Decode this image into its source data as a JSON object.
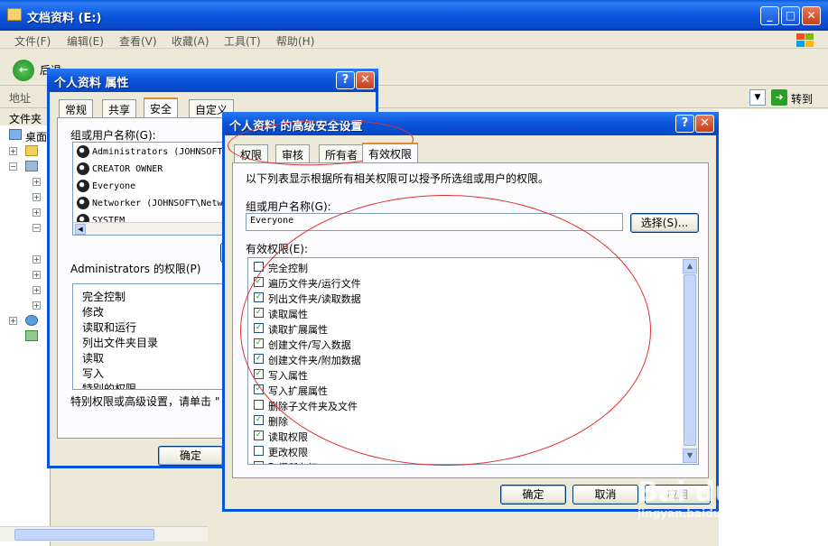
{
  "explorer": {
    "title": "文档资料 (E:)",
    "menu": [
      "文件(F)",
      "编辑(E)",
      "查看(V)",
      "收藏(A)",
      "工具(T)",
      "帮助(H)"
    ],
    "back_label": "后退",
    "address_label": "地址",
    "go_label": "转到",
    "folders_label": "文件夹",
    "tree_first": "桌面"
  },
  "properties": {
    "title": "个人资料 属性",
    "tabs": [
      "常规",
      "共享",
      "安全",
      "自定义"
    ],
    "active_tab": "安全",
    "group_label": "组或用户名称(G):",
    "users": [
      "Administrators (JOHNSOFT\\",
      "CREATOR OWNER",
      "Everyone",
      "Networker (JOHNSOFT\\Netw",
      "SYSTEM"
    ],
    "perm_label": "Administrators 的权限(P)",
    "perms": [
      "完全控制",
      "修改",
      "读取和运行",
      "列出文件夹目录",
      "读取",
      "写入",
      "特别的权限"
    ],
    "footer_text": "特别权限或高级设置，请单击 \"",
    "ok_label": "确定"
  },
  "advanced": {
    "title": "个人资料 的高级安全设置",
    "tabs": [
      "权限",
      "审核",
      "所有者",
      "有效权限"
    ],
    "active_tab": "有效权限",
    "description": "以下列表显示根据所有相关权限可以授予所选组或用户的权限。",
    "group_label": "组或用户名称(G):",
    "group_value": "Everyone",
    "select_label": "选择(S)...",
    "effective_label": "有效权限(E):",
    "permissions": [
      {
        "label": "完全控制",
        "checked": false
      },
      {
        "label": "遍历文件夹/运行文件",
        "checked": true
      },
      {
        "label": "列出文件夹/读取数据",
        "checked": true
      },
      {
        "label": "读取属性",
        "checked": true
      },
      {
        "label": "读取扩展属性",
        "checked": true
      },
      {
        "label": "创建文件/写入数据",
        "checked": true
      },
      {
        "label": "创建文件夹/附加数据",
        "checked": true
      },
      {
        "label": "写入属性",
        "checked": true
      },
      {
        "label": "写入扩展属性",
        "checked": true
      },
      {
        "label": "删除子文件夹及文件",
        "checked": false
      },
      {
        "label": "删除",
        "checked": true
      },
      {
        "label": "读取权限",
        "checked": true
      },
      {
        "label": "更改权限",
        "checked": false
      },
      {
        "label": "取得所有权",
        "checked": false
      }
    ],
    "ok_label": "确定",
    "cancel_label": "取消",
    "apply_label": "应用"
  },
  "watermark": {
    "brand": "Bai du 经验",
    "url": "jingyan.baidu.com"
  }
}
